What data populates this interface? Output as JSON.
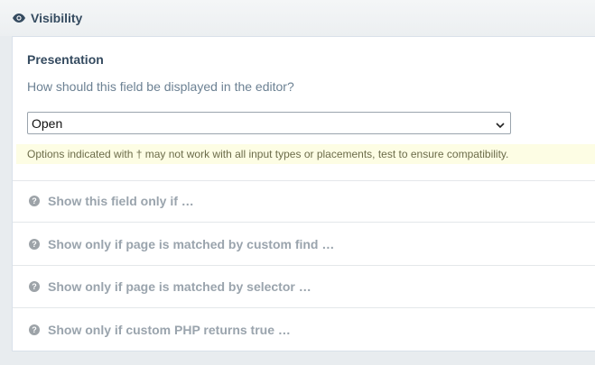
{
  "fieldset": {
    "icon": "eye-icon",
    "title": "Visibility"
  },
  "presentation": {
    "label": "Presentation",
    "description": "How should this field be displayed in the editor?",
    "select_value": "Open",
    "notes": "Options indicated with † may not work with all input types or placements, test to ensure compatibility."
  },
  "conditions": [
    {
      "icon": "help-icon",
      "label": "Show this field only if …"
    },
    {
      "icon": "help-icon",
      "label": "Show only if page is matched by custom find …"
    },
    {
      "icon": "help-icon",
      "label": "Show only if page is matched by selector …"
    },
    {
      "icon": "help-icon",
      "label": "Show only if custom PHP returns true …"
    }
  ],
  "colors": {
    "heading": "#354b60",
    "muted": "#9aa4ad",
    "notes_bg": "#fdfde4"
  }
}
